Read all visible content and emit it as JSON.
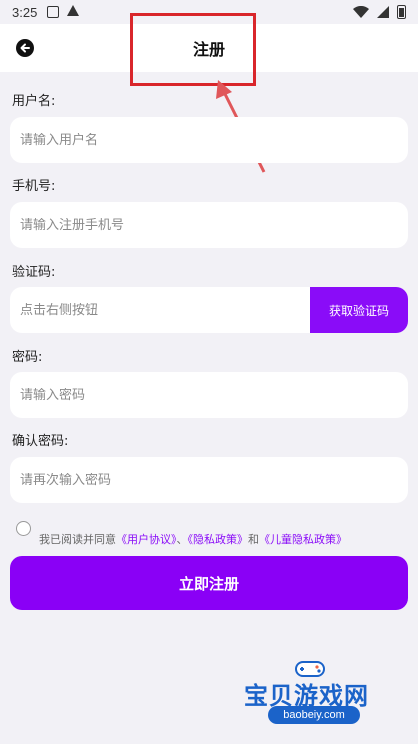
{
  "status_bar": {
    "time": "3:25"
  },
  "header": {
    "title": "注册"
  },
  "form": {
    "username": {
      "label": "用户名:",
      "placeholder": "请输入用户名"
    },
    "phone": {
      "label": "手机号:",
      "placeholder": "请输入注册手机号"
    },
    "code": {
      "label": "验证码:",
      "placeholder": "点击右侧按钮",
      "button": "获取验证码"
    },
    "password": {
      "label": "密码:",
      "placeholder": "请输入密码"
    },
    "confirm": {
      "label": "确认密码:",
      "placeholder": "请再次输入密码"
    }
  },
  "agreement": {
    "prefix": "我已阅读并同意",
    "user_agreement": "《用户协议》",
    "sep1": "、",
    "privacy": "《隐私政策》",
    "and": "和",
    "child_privacy": "《儿童隐私政策》"
  },
  "submit_label": "立即注册",
  "watermark": {
    "brand": "宝贝游戏网",
    "url": "baobeiy.com"
  },
  "colors": {
    "accent": "#8a00f6",
    "annotation": "#d9262b",
    "watermark": "#1b63c9"
  }
}
